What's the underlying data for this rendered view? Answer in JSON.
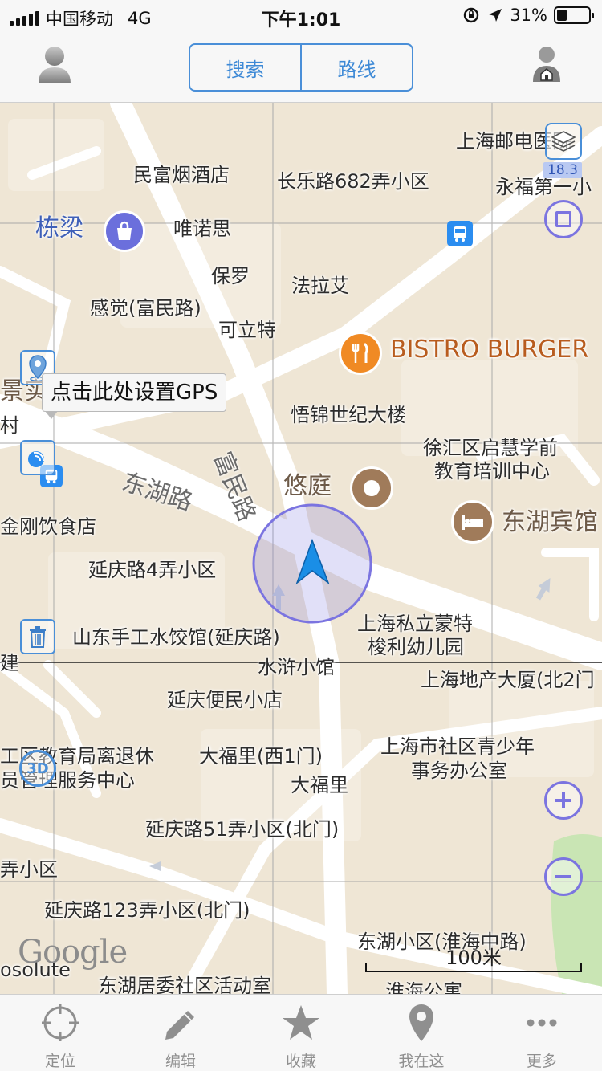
{
  "status_bar": {
    "carrier": "中国移动",
    "network": "4G",
    "time": "下午1:01",
    "battery": "31%",
    "battery_level": 0.31
  },
  "navbar": {
    "segments": [
      "搜索",
      "路线"
    ]
  },
  "map": {
    "labels": [
      {
        "id": "youzheng",
        "text": "上海邮电医院"
      },
      {
        "id": "minfu",
        "text": "民富烟酒店"
      },
      {
        "id": "changle682",
        "text": "长乐路682弄小区"
      },
      {
        "id": "yongfu",
        "text": "永福第一小"
      },
      {
        "id": "dongliang",
        "text": "栋梁"
      },
      {
        "id": "weinuosi",
        "text": "唯诺思"
      },
      {
        "id": "baoluo",
        "text": "保罗"
      },
      {
        "id": "falaai",
        "text": "法拉艾"
      },
      {
        "id": "ganjue",
        "text": "感觉(富民路)"
      },
      {
        "id": "kelite",
        "text": "可立特"
      },
      {
        "id": "bistro",
        "text": "BISTRO BURGER"
      },
      {
        "id": "jingyuan",
        "text": "景实"
      },
      {
        "id": "cun",
        "text": "村"
      },
      {
        "id": "wujin",
        "text": "悟锦世纪大楼"
      },
      {
        "id": "xuhui",
        "text": "徐汇区启慧学前"
      },
      {
        "id": "jiaoyu",
        "text": "教育培训中心"
      },
      {
        "id": "youting",
        "text": "悠庭"
      },
      {
        "id": "donghubinguan",
        "text": "东湖宾馆"
      },
      {
        "id": "jingang",
        "text": "金刚饮食店"
      },
      {
        "id": "yanqing4",
        "text": "延庆路4弄小区"
      },
      {
        "id": "shandong",
        "text": "山东手工水饺馆(延庆路)"
      },
      {
        "id": "mengte1",
        "text": "上海私立蒙特"
      },
      {
        "id": "mengte2",
        "text": "梭利幼儿园"
      },
      {
        "id": "shuihu",
        "text": "水浒小馆"
      },
      {
        "id": "dichan",
        "text": "上海地产大厦(北2门"
      },
      {
        "id": "jian",
        "text": "建"
      },
      {
        "id": "bianmin",
        "text": "延庆便民小店"
      },
      {
        "id": "qujiaoyu",
        "text": "工区教育局离退休"
      },
      {
        "id": "fuwu",
        "text": "员管理服务中心"
      },
      {
        "id": "dafuli1",
        "text": "大福里(西1门)"
      },
      {
        "id": "shequ1",
        "text": "上海市社区青少年"
      },
      {
        "id": "shequ2",
        "text": "事务办公室"
      },
      {
        "id": "dafuli",
        "text": "大福里"
      },
      {
        "id": "yanqing51",
        "text": "延庆路51弄小区(北门)"
      },
      {
        "id": "nongxiaoqu",
        "text": "弄小区"
      },
      {
        "id": "yanqing123",
        "text": "延庆路123弄小区(北门)"
      },
      {
        "id": "donghuxiaoqu",
        "text": "东湖小区(淮海中路)"
      },
      {
        "id": "absolute",
        "text": "osolute"
      },
      {
        "id": "juwei",
        "text": "东湖居委社区活动室"
      },
      {
        "id": "huaihai",
        "text": "淮海公寓"
      },
      {
        "id": "donghulu",
        "text": "东湖路"
      },
      {
        "id": "fuminlu",
        "text": "富民路"
      }
    ],
    "zoom_level": "18.3",
    "gps_tip": "点击此处设置GPS",
    "scale": "100米",
    "watermark": "Google"
  },
  "tabs": [
    {
      "label": "定位",
      "icon": "locate-icon"
    },
    {
      "label": "编辑",
      "icon": "pencil-icon"
    },
    {
      "label": "收藏",
      "icon": "star-icon"
    },
    {
      "label": "我在这",
      "icon": "pin-icon"
    },
    {
      "label": "更多",
      "icon": "more-icon"
    }
  ],
  "colors": {
    "accent": "#3d89d6",
    "control": "#7b74e0",
    "map_bg": "#efe6d5",
    "road": "#ffffff"
  }
}
